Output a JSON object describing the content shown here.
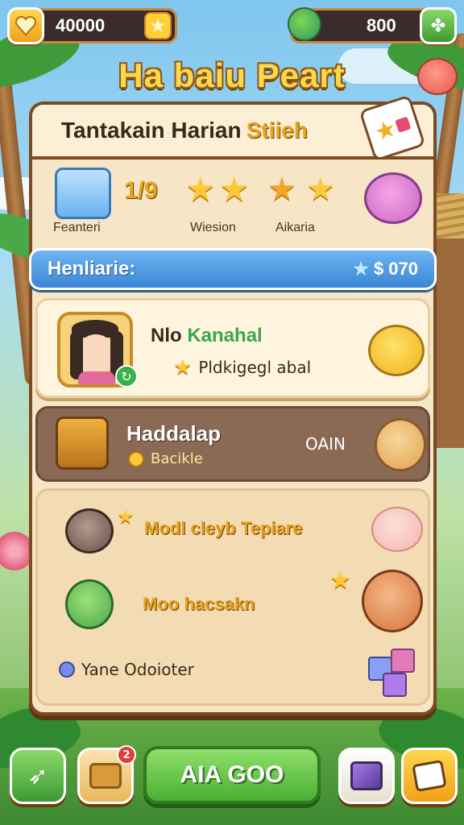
{
  "top_bar": {
    "coins_value": "40000",
    "gems_value": "800"
  },
  "title": "Ha baiu Peart",
  "panel": {
    "header_text": "Tantakain Harian",
    "header_highlight": "Stiieh",
    "level_text": "1/9",
    "label_left": "Feanteri",
    "label_mid": "Wiesion",
    "label_right": "Aikaria",
    "blue_bar_label": "Henliarie:",
    "blue_bar_value": "$ 070"
  },
  "cards": {
    "card1_title_1": "Nlo",
    "card1_title_2": "Kanahal",
    "card1_subtitle": "Pldkigegl abal",
    "card2_title": "Haddalap",
    "card2_subtitle": "Bacikle",
    "card2_value": "OAIN",
    "row3_text": "Modl cleyb Tepiare",
    "row4_text": "Moo hacsakn",
    "row5_text": "Yane  Odoioter"
  },
  "bottom": {
    "play_label": "AIA GOO",
    "badge_count": "2"
  },
  "colors": {
    "accent_gold": "#ffd84a",
    "panel_bg": "#f6e6c6",
    "blue_bar": "#3b86d6",
    "play_green": "#4aae34"
  }
}
